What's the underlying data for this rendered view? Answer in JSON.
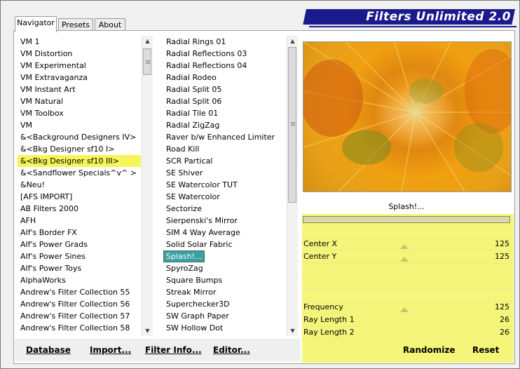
{
  "app": {
    "title": "Filters Unlimited 2.0"
  },
  "tabs": [
    {
      "label": "Navigator",
      "active": true
    },
    {
      "label": "Presets",
      "active": false
    },
    {
      "label": "About",
      "active": false
    }
  ],
  "categories": [
    {
      "label": "VM 1"
    },
    {
      "label": "VM Distortion"
    },
    {
      "label": "VM Experimental"
    },
    {
      "label": "VM Extravaganza"
    },
    {
      "label": "VM Instant Art"
    },
    {
      "label": "VM Natural"
    },
    {
      "label": "VM Toolbox"
    },
    {
      "label": "VM"
    },
    {
      "label": "&<Background Designers IV>"
    },
    {
      "label": "&<Bkg Designer sf10 I>"
    },
    {
      "label": "&<Bkg Designer sf10 III>",
      "highlighted": true
    },
    {
      "label": "&<Sandflower Specials^v^ >"
    },
    {
      "label": "&Neu!"
    },
    {
      "label": "[AFS IMPORT]"
    },
    {
      "label": "AB Filters 2000"
    },
    {
      "label": "AFH"
    },
    {
      "label": "Alf's Border FX"
    },
    {
      "label": "Alf's Power Grads"
    },
    {
      "label": "Alf's Power Sines"
    },
    {
      "label": "Alf's Power Toys"
    },
    {
      "label": "AlphaWorks"
    },
    {
      "label": "Andrew's Filter Collection 55"
    },
    {
      "label": "Andrew's Filter Collection 56"
    },
    {
      "label": "Andrew's Filter Collection 57"
    },
    {
      "label": "Andrew's Filter Collection 58"
    }
  ],
  "filters": [
    {
      "label": "Radial  Rings 01"
    },
    {
      "label": "Radial Reflections 03"
    },
    {
      "label": "Radial Reflections 04"
    },
    {
      "label": "Radial Rodeo"
    },
    {
      "label": "Radial Split 05"
    },
    {
      "label": "Radial Split 06"
    },
    {
      "label": "Radial Tile 01"
    },
    {
      "label": "Radial ZigZag"
    },
    {
      "label": "Raver b/w Enhanced Limiter"
    },
    {
      "label": "Road Kill"
    },
    {
      "label": "SCR  Partical"
    },
    {
      "label": "SE Shiver"
    },
    {
      "label": "SE Watercolor TUT"
    },
    {
      "label": "SE Watercolor"
    },
    {
      "label": "Sectorize"
    },
    {
      "label": "Sierpenski's Mirror"
    },
    {
      "label": "SIM 4 Way Average"
    },
    {
      "label": "Solid Solar Fabric"
    },
    {
      "label": "Splash!...",
      "selected": true
    },
    {
      "label": "SpyroZag"
    },
    {
      "label": "Square Bumps"
    },
    {
      "label": "Streak Mirror"
    },
    {
      "label": "Superchecker3D"
    },
    {
      "label": "SW Graph Paper"
    },
    {
      "label": "SW Hollow Dot"
    }
  ],
  "preview": {
    "filter_name": "Splash!..."
  },
  "params": [
    {
      "name": "Center X",
      "value": "125"
    },
    {
      "name": "Center Y",
      "value": "125"
    },
    {
      "name": "Frequency",
      "value": "125"
    },
    {
      "name": "Ray Length 1",
      "value": "26"
    },
    {
      "name": "Ray Length 2",
      "value": "26"
    }
  ],
  "buttons": {
    "database": "Database",
    "import": "Import...",
    "filter_info": "Filter Info...",
    "editor": "Editor...",
    "randomize": "Randomize",
    "reset": "Reset"
  },
  "colors": {
    "banner": "#1a1a8c",
    "highlight": "#f5f55a",
    "selection": "#3aa0a0",
    "param_panel": "#f5f57a"
  }
}
